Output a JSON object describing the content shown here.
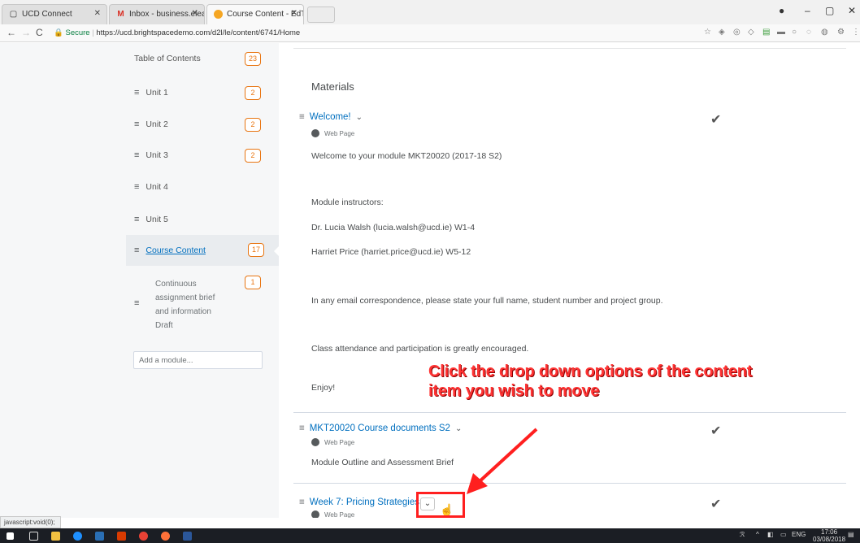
{
  "browser": {
    "tabs": [
      {
        "label": "UCD Connect",
        "icon": "page-icon"
      },
      {
        "label": "Inbox - business.elearnin",
        "icon": "gmail-icon"
      },
      {
        "label": "Course Content - EdTech",
        "icon": "brightspace-icon"
      }
    ],
    "secure_label": "Secure",
    "url": "https://ucd.brightspacedemo.com/d2l/le/content/6741/Home",
    "status_url": "javascript:void(0);"
  },
  "sidebar": {
    "toc_label": "Table of Contents",
    "toc_count": "23",
    "units": [
      {
        "label": "Unit 1",
        "count": "2"
      },
      {
        "label": "Unit 2",
        "count": "2"
      },
      {
        "label": "Unit 3",
        "count": "2"
      },
      {
        "label": "Unit 4",
        "count": ""
      },
      {
        "label": "Unit 5",
        "count": ""
      }
    ],
    "active_module": {
      "label": "Course Content",
      "count": "17"
    },
    "draft_module": {
      "lines": [
        "Continuous",
        "assignment brief",
        "and information",
        "Draft"
      ],
      "count": "1"
    },
    "add_module_placeholder": "Add a module..."
  },
  "main": {
    "heading": "Materials",
    "items": [
      {
        "title": "Welcome!",
        "type": "Web Page"
      },
      {
        "title": "MKT20020 Course documents S2",
        "type": "Web Page"
      },
      {
        "title": "Week 7: Pricing Strategies",
        "type": "Web Page"
      }
    ],
    "welcome_paragraphs": [
      "Welcome to your module MKT20020 (2017-18 S2)",
      "Module instructors:",
      "Dr. Lucia Walsh (lucia.walsh@ucd.ie) W1-4",
      "Harriet Price (harriet.price@ucd.ie) W5-12",
      "In any email correspondence, please state your full name, student number and project group.",
      "Class attendance and participation is greatly encouraged.",
      "Enjoy!"
    ],
    "course_docs_paragraph": "Module Outline and Assessment Brief"
  },
  "annotation": {
    "line1": "Click the drop down options of the content",
    "line2": "item you wish to move",
    "color": "#ff1f1f"
  },
  "taskbar": {
    "lang": "ENG",
    "time": "17:06",
    "date": "03/08/2018"
  },
  "colors": {
    "link": "#006fbf",
    "badge": "#e87511"
  }
}
